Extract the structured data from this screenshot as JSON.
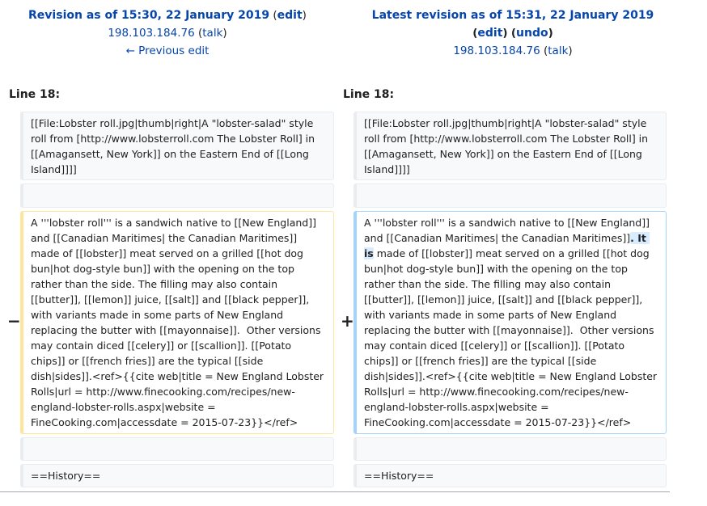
{
  "left_header": {
    "revision_label": "Revision as of 15:30, 22 January 2019",
    "edit_label": "edit",
    "user_ip": "198.103.184.76",
    "talk_label": "talk",
    "previous_edit_label": "← Previous edit"
  },
  "right_header": {
    "revision_label": "Latest revision as of 15:31, 22 January 2019",
    "edit_label": "edit",
    "undo_label": "undo",
    "user_ip": "198.103.184.76",
    "talk_label": "talk"
  },
  "line_label_left": "Line 18:",
  "line_label_right": "Line 18:",
  "diff": {
    "context_top": "[[File:Lobster roll.jpg|thumb|right|A \"lobster-salad\" style roll from [http://www.lobsterroll.com The Lobster Roll] in [[Amagansett, New York]] on the Eastern End of [[Long Island]]]]",
    "removed_text": "A '''lobster roll''' is a sandwich native to [[New England]] and [[Canadian Maritimes| the Canadian Maritimes]] made of [[lobster]] meat served on a grilled [[hot dog bun|hot dog-style bun]] with the opening on the top rather than the side. The filling may also contain [[butter]], [[lemon]] juice, [[salt]] and [[black pepper]], with variants made in some parts of New England replacing the butter with [[mayonnaise]].  Other versions may contain diced [[celery]] or [[scallion]]. [[Potato chips]] or [[french fries]] are the typical [[side dish|sides]].<ref>{{cite web|title = New England Lobster Rolls|url = http://www.finecooking.com/recipes/new-england-lobster-rolls.aspx|website = FineCooking.com|accessdate = 2015-07-23}}</ref>",
    "added_text_before": "A '''lobster roll''' is a sandwich native to [[New England]] and [[Canadian Maritimes| the Canadian Maritimes]]",
    "added_text_highlight": ". It is",
    "added_text_after": " made of [[lobster]] meat served on a grilled [[hot dog bun|hot dog-style bun]] with the opening on the top rather than the side. The filling may also contain [[butter]], [[lemon]] juice, [[salt]] and [[black pepper]], with variants made in some parts of New England replacing the butter with [[mayonnaise]].  Other versions may contain diced [[celery]] or [[scallion]]. [[Potato chips]] or [[french fries]] are the typical [[side dish|sides]].<ref>{{cite web|title = New England Lobster Rolls|url = http://www.finecooking.com/recipes/new-england-lobster-rolls.aspx|website = FineCooking.com|accessdate = 2015-07-23}}</ref>",
    "minus_marker": "−",
    "plus_marker": "+",
    "context_bottom": "==History=="
  },
  "colors": {
    "link": "#0645ad",
    "removed_border": "#ffe49c",
    "added_border": "#a3d3ff",
    "added_inline_bg": "#d8ecff",
    "context_bg": "#f8f9fa"
  }
}
